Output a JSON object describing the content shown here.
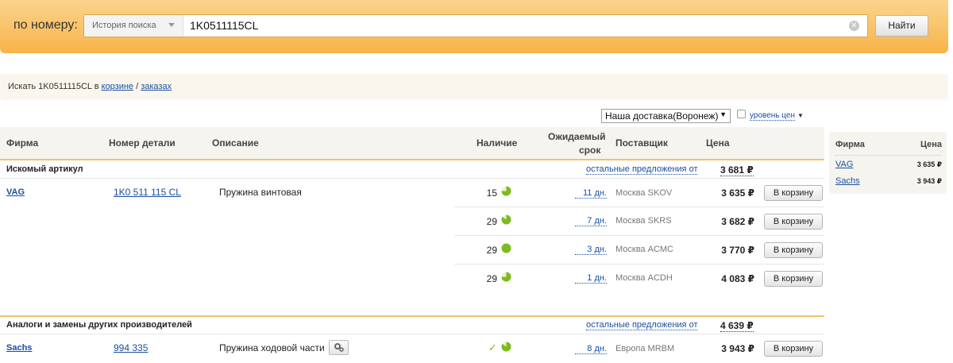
{
  "search": {
    "by_number_label": "по номеру:",
    "history_label": "История поиска",
    "query": "1K0511115CL",
    "find_button": "Найти"
  },
  "strip": {
    "prefix": "Искать 1K0511115CL в",
    "cart_link": "корзине",
    "separator": " / ",
    "orders_link": "заказах"
  },
  "delivery": {
    "selected": "Наша доставка(Воронеж)",
    "price_level_label": "уровень цен"
  },
  "table": {
    "headers": {
      "brand": "Фирма",
      "part_number": "Номер детали",
      "description": "Описание",
      "availability": "Наличие",
      "expected_line1": "Ожидаемый",
      "expected_line2": "срок",
      "supplier": "Поставщик",
      "price": "Цена"
    },
    "searched_section": {
      "title": "Искомый артикул",
      "others_link": "остальные предложения от",
      "min_price": "3 681 ₽"
    },
    "main_part": {
      "brand": "VAG",
      "number": "1K0 511 115 CL",
      "description": "Пружина винтовая"
    },
    "offers": [
      {
        "stock": "15",
        "days": "11 дн.",
        "supplier": "Москва SKOV",
        "price": "3 635 ₽",
        "button": "В корзину",
        "pie": 0.75
      },
      {
        "stock": "29",
        "days": "7 дн.",
        "supplier": "Москва SKRS",
        "price": "3 682 ₽",
        "button": "В корзину",
        "pie": 0.85
      },
      {
        "stock": "29",
        "days": "3 дн.",
        "supplier": "Москва ACMC",
        "price": "3 770 ₽",
        "button": "В корзину",
        "pie": 1.0
      },
      {
        "stock": "29",
        "days": "1 дн.",
        "supplier": "Москва ACDH",
        "price": "4 083 ₽",
        "button": "В корзину",
        "pie": 0.75
      }
    ],
    "analogs_section": {
      "title": "Аналоги и замены других производителей",
      "others_link": "остальные предложения от",
      "min_price": "4 639 ₽"
    },
    "analog": {
      "brand": "Sachs",
      "number": "994 335",
      "description": "Пружина ходовой части",
      "days": "8 дн.",
      "supplier": "Европа MRBM",
      "price": "3 943 ₽",
      "button": "В корзину",
      "pie": 0.85
    }
  },
  "side_panel": {
    "brand_header": "Фирма",
    "price_header": "Цена",
    "rows": [
      {
        "brand": "VAG",
        "price": "3 635 ₽"
      },
      {
        "brand": "Sachs",
        "price": "3 943 ₽"
      }
    ]
  },
  "colors": {
    "accent_orange": "#f7b347",
    "pie_green": "#7cbb1e",
    "link_blue": "#1a4fa0"
  }
}
